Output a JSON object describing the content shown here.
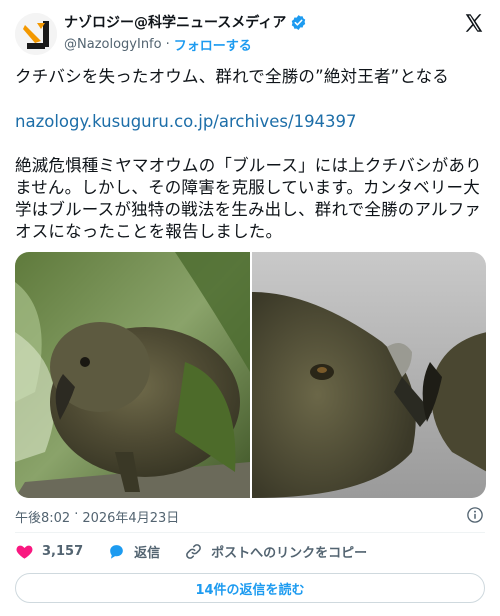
{
  "account": {
    "name": "ナゾロジー@科学ニュースメディア",
    "handle": "@NazologyInfo",
    "separator": "·",
    "follow_label": "フォローする",
    "verified": true
  },
  "post": {
    "title_text": "クチバシを失ったオウム、群れで全勝の”絶対王者”となる",
    "link_text": "nazology.kusuguru.co.jp/archives/194397",
    "body_text": "絶滅危惧種ミヤマオウムの「ブルース」には上クチバシがありません。しかし、その障害を克服しています。カンタベリー大学はブルースが独特の戦法を生み出し、群れで全勝のアルファオスになったことを報告しました。",
    "timestamp": "午後8:02",
    "date_separator": "·",
    "date": "2026年4月23日"
  },
  "actions": {
    "like_count": "3,157",
    "reply_label": "返信",
    "copy_link_label": "ポストへのリンクをコピー",
    "read_replies_label": "14件の返信を読む"
  },
  "icons": {
    "verified": "verified-badge-icon",
    "x_logo": "x-logo-icon",
    "info": "info-icon",
    "like": "heart-icon",
    "reply": "reply-bubble-icon",
    "link": "link-icon"
  },
  "colors": {
    "accent": "#1d9bf0",
    "like": "#f91880",
    "text": "#0f1419",
    "muted": "#536471",
    "brand_orange": "#f39800"
  }
}
